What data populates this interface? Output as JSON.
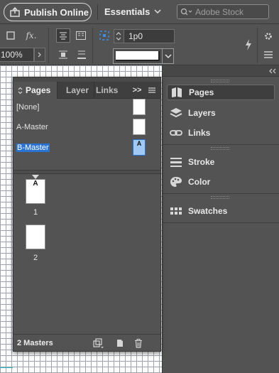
{
  "topbar": {
    "publish_label": "Publish Online",
    "workspace_label": "Essentials",
    "search_placeholder": "Adobe Stock"
  },
  "controlbar": {
    "zoom_value": "100%",
    "offset_value": "1p0"
  },
  "pages_panel": {
    "tabs": [
      {
        "label": "Pages",
        "active": true
      },
      {
        "label": "Layers",
        "active": false
      },
      {
        "label": "Links",
        "active": false
      }
    ],
    "masters": [
      {
        "label": "[None]",
        "thumb_letter": "",
        "selected": false
      },
      {
        "label": "A-Master",
        "thumb_letter": "",
        "selected": false
      },
      {
        "label": "B-Master",
        "thumb_letter": "A",
        "selected": true
      }
    ],
    "pages": [
      {
        "number": "1",
        "master_letter": "A"
      },
      {
        "number": "2",
        "master_letter": ""
      }
    ],
    "footer_status": "2 Masters"
  },
  "right_dock": {
    "items": [
      {
        "label": "Pages",
        "icon": "pages-icon",
        "active": true
      },
      {
        "label": "Layers",
        "icon": "layers-icon",
        "active": false
      },
      {
        "label": "Links",
        "icon": "links-icon",
        "active": false
      },
      {
        "label": "Stroke",
        "icon": "stroke-icon",
        "active": false
      },
      {
        "label": "Color",
        "icon": "color-palette-icon",
        "active": false
      },
      {
        "label": "Swatches",
        "icon": "swatches-icon",
        "active": false
      }
    ]
  },
  "colors": {
    "accent": "#2b73d0",
    "panel_bg": "#535353",
    "canvas_grid": "#9ea4ad"
  }
}
